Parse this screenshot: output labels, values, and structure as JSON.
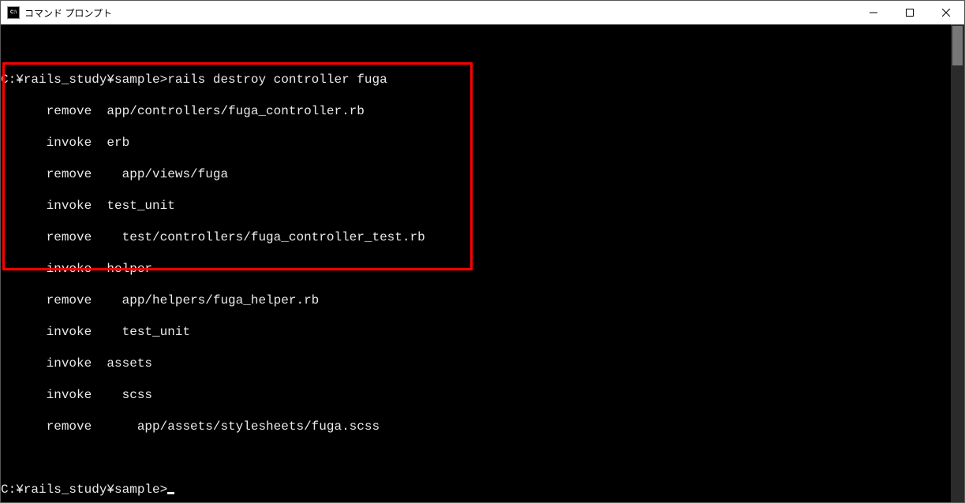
{
  "window": {
    "title": "コマンド プロンプト",
    "icon_label": "C:\\"
  },
  "terminal": {
    "prompt1": "C:¥rails_study¥sample>",
    "command1": "rails destroy controller fuga",
    "lines": [
      "      remove  app/controllers/fuga_controller.rb",
      "      invoke  erb",
      "      remove    app/views/fuga",
      "      invoke  test_unit",
      "      remove    test/controllers/fuga_controller_test.rb",
      "      invoke  helper",
      "      remove    app/helpers/fuga_helper.rb",
      "      invoke    test_unit",
      "      invoke  assets",
      "      invoke    scss",
      "      remove      app/assets/stylesheets/fuga.scss"
    ],
    "prompt2": "C:¥rails_study¥sample>"
  }
}
